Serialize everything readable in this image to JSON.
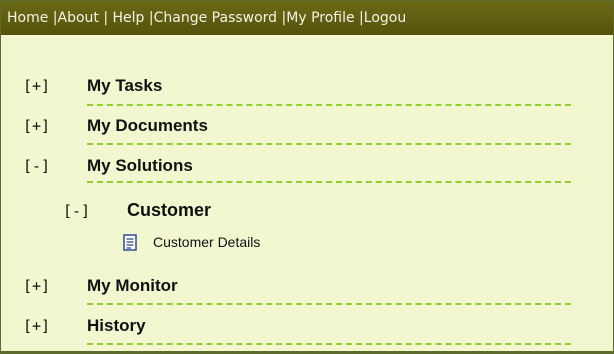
{
  "topnav": {
    "links": [
      "Home ",
      "About ",
      " Help ",
      "Change Password ",
      "My Profile ",
      "Logou"
    ],
    "separator": "|"
  },
  "tree": {
    "my_tasks": {
      "toggle": "[+]",
      "label": "My Tasks"
    },
    "my_documents": {
      "toggle": "[+]",
      "label": "My Documents"
    },
    "my_solutions": {
      "toggle": "[-]",
      "label": "My Solutions"
    },
    "customer": {
      "toggle": "[-]",
      "label": "Customer"
    },
    "customer_details": {
      "label": "Customer Details",
      "icon": "document-icon"
    },
    "my_monitor": {
      "toggle": "[+]",
      "label": "My Monitor"
    },
    "history": {
      "toggle": "[+]",
      "label": "History"
    }
  },
  "colors": {
    "header_bg": "#5f5d10",
    "panel_bg": "#f2f7cf",
    "dash": "#90d02e"
  }
}
